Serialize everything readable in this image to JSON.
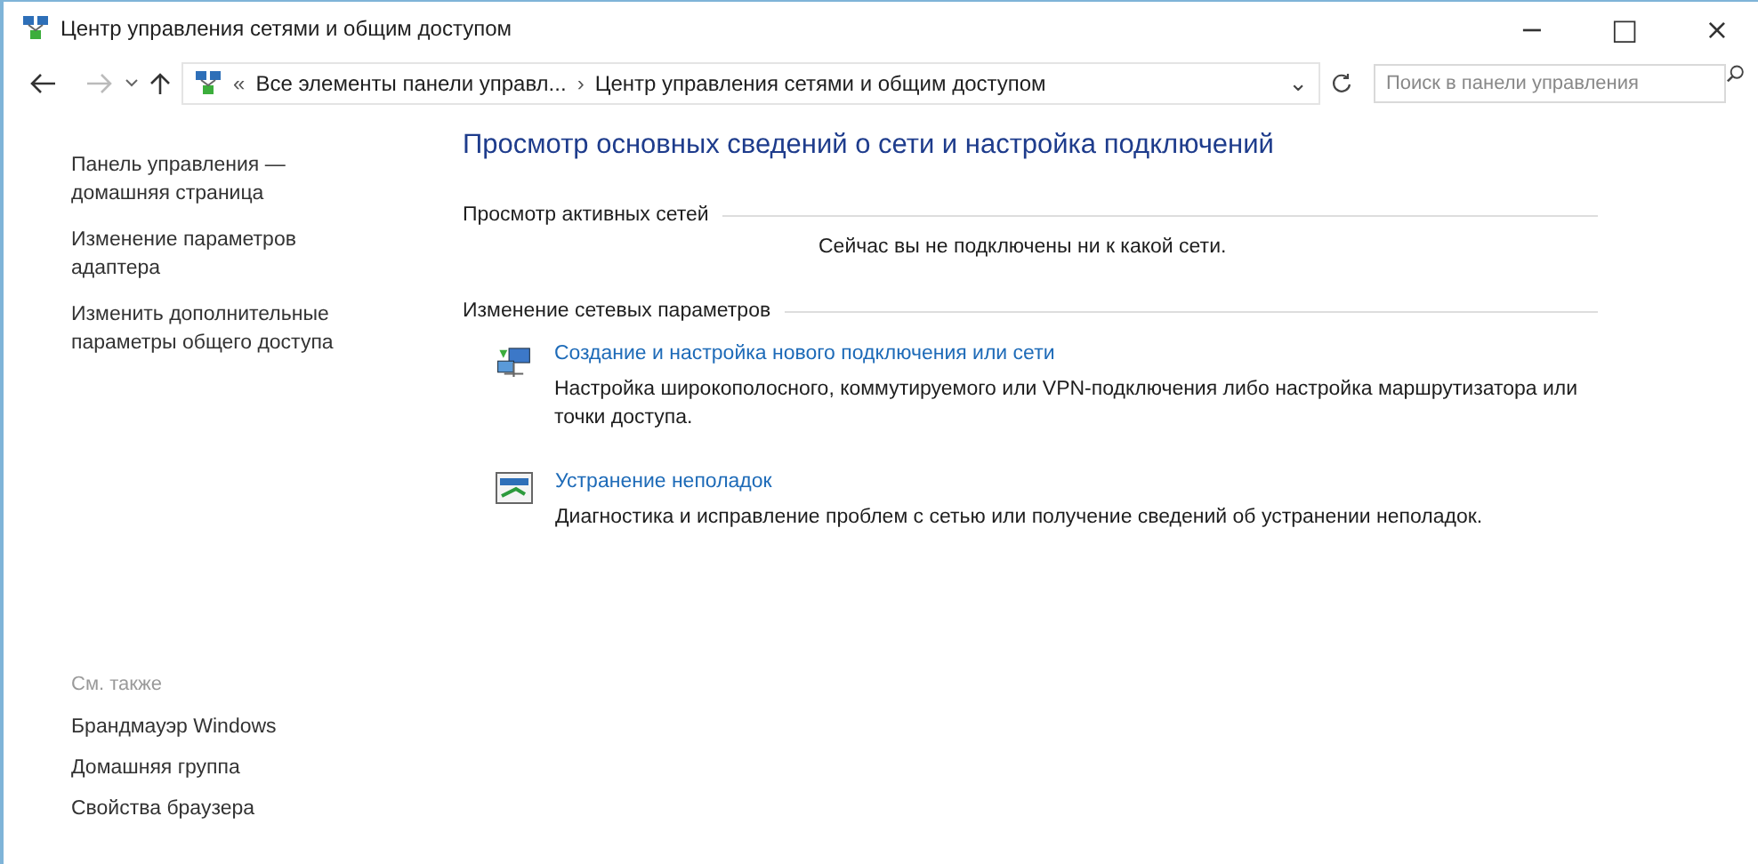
{
  "window": {
    "title": "Центр управления сетями и общим доступом",
    "controls": [
      "−",
      "□",
      "×"
    ]
  },
  "address_bar": {
    "overflow": "«",
    "breadcrumbs": [
      "Все элементы панели управл...",
      "Центр управления сетями и общим доступом"
    ],
    "separator": "›",
    "dropdown": "⌄"
  },
  "search": {
    "placeholder": "Поиск в панели управления"
  },
  "sidebar": {
    "links": [
      "Панель управления — домашняя страница",
      "Изменение параметров адаптера",
      "Изменить дополнительные параметры общего доступа"
    ],
    "see_also": {
      "heading": "См. также",
      "links": [
        "Брандмауэр Windows",
        "Домашняя группа",
        "Свойства браузера"
      ]
    }
  },
  "main": {
    "heading": "Просмотр основных сведений о сети и настройка подключений",
    "active_networks": {
      "heading": "Просмотр активных сетей",
      "message": "Сейчас вы не подключены ни к какой сети."
    },
    "settings": {
      "heading": "Изменение сетевых параметров",
      "tasks": [
        {
          "kind": "network",
          "title": "Создание и настройка нового подключения или сети",
          "description": "Настройка широкополосного, коммутируемого или VPN-подключения либо настройка маршрутизатора или точки доступа."
        },
        {
          "kind": "troubleshoot",
          "title": "Устранение неполадок",
          "description": "Диагностика и исправление проблем с сетью или получение сведений об устранении неполадок."
        }
      ]
    }
  }
}
